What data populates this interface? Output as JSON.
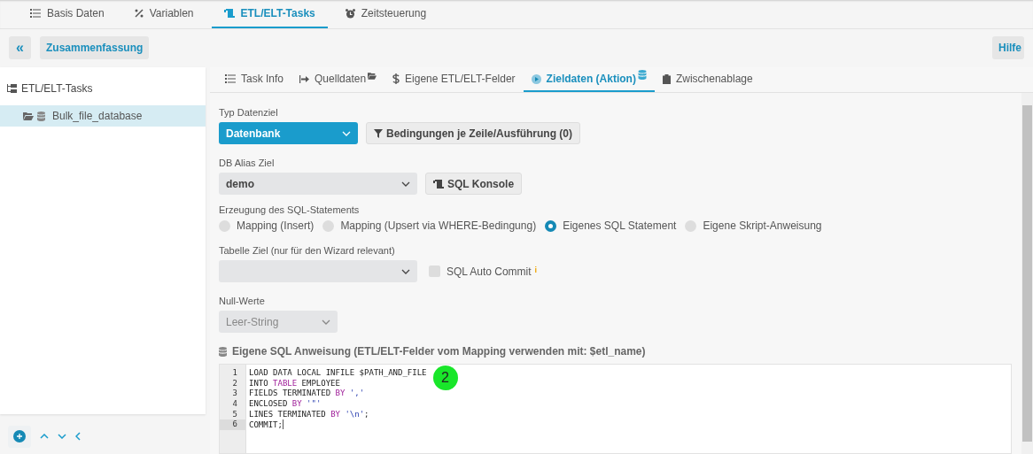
{
  "top_tabs": [
    {
      "label": "Basis Daten",
      "selected": false
    },
    {
      "label": "Variablen",
      "selected": false
    },
    {
      "label": "ETL/ELT-Tasks",
      "selected": true
    },
    {
      "label": "Zeitsteuerung",
      "selected": false
    }
  ],
  "toolbar": {
    "collapse": "«",
    "summary": "Zusammenfassung",
    "help": "Hilfe"
  },
  "tree": {
    "title": "ETL/ELT-Tasks",
    "items": [
      {
        "label": "Bulk_file_database",
        "selected": true
      }
    ]
  },
  "sub_tabs": [
    {
      "label": "Task Info",
      "badge": false,
      "selected": false
    },
    {
      "label": "Quelldaten",
      "badge": true,
      "selected": false
    },
    {
      "label": "Eigene ETL/ELT-Felder",
      "badge": false,
      "selected": false
    },
    {
      "label": "Zieldaten (Aktion)",
      "badge": true,
      "selected": true
    },
    {
      "label": "Zwischenablage",
      "badge": false,
      "selected": false
    }
  ],
  "form": {
    "target_type": {
      "label": "Typ Datenziel",
      "value": "Datenbank"
    },
    "conditions_button": "Bedingungen je Zeile/Ausführung (0)",
    "db_alias": {
      "label": "DB Alias Ziel",
      "value": "demo"
    },
    "sql_console_button": "SQL Konsole",
    "generation": {
      "label": "Erzeugung des SQL-Statements",
      "options": [
        {
          "label": "Mapping (Insert)",
          "selected": false
        },
        {
          "label": "Mapping (Upsert via WHERE-Bedingung)",
          "selected": false
        },
        {
          "label": "Eigenes SQL Statement",
          "selected": true
        },
        {
          "label": "Eigene Skript-Anweisung",
          "selected": false
        }
      ]
    },
    "target_table": {
      "label": "Tabelle Ziel (nur für den Wizard relevant)"
    },
    "auto_commit": {
      "label": "SQL Auto Commit",
      "checked": false,
      "info": "i"
    },
    "null_values": {
      "label": "Null-Werte",
      "value": "Leer-String",
      "disabled": true
    },
    "sql_heading": "Eigene SQL Anweisung (ETL/ELT-Felder vom Mapping verwenden mit: $etl_name)"
  },
  "editor": {
    "lines": [
      {
        "number": "1",
        "current": false,
        "tokens": [
          {
            "text": "LOAD DATA LOCAL INFILE $PATH_AND_FILE",
            "kind": "plain"
          }
        ]
      },
      {
        "number": "2",
        "current": false,
        "tokens": [
          {
            "text": "INTO ",
            "kind": "plain"
          },
          {
            "text": "TABLE",
            "kind": "keyword"
          },
          {
            "text": " EMPLOYEE",
            "kind": "plain"
          }
        ]
      },
      {
        "number": "3",
        "current": false,
        "tokens": [
          {
            "text": "FIELDS TERMINATED ",
            "kind": "plain"
          },
          {
            "text": "BY",
            "kind": "keyword"
          },
          {
            "text": " ','",
            "kind": "string"
          }
        ]
      },
      {
        "number": "4",
        "current": false,
        "tokens": [
          {
            "text": "ENCLOSED ",
            "kind": "plain"
          },
          {
            "text": "BY",
            "kind": "keyword"
          },
          {
            "text": " '\"'",
            "kind": "string"
          }
        ]
      },
      {
        "number": "5",
        "current": false,
        "tokens": [
          {
            "text": "LINES TERMINATED ",
            "kind": "plain"
          },
          {
            "text": "BY",
            "kind": "keyword"
          },
          {
            "text": " '\\n'",
            "kind": "string"
          },
          {
            "text": ";",
            "kind": "plain"
          }
        ]
      },
      {
        "number": "6",
        "current": true,
        "tokens": [
          {
            "text": "COMMIT;",
            "kind": "plain"
          }
        ]
      }
    ]
  },
  "step_marker": "2"
}
